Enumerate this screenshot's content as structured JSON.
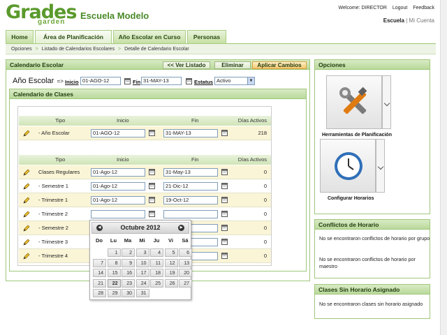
{
  "header": {
    "logo_text": "Grades",
    "logo_sub": "garden",
    "school_name": "Escuela Modelo",
    "welcome": "Welcome: DIRECTOR",
    "logout": "Logout",
    "feedback": "Feedback",
    "school_link": "Escuela",
    "account_link": "Mi Cuenta"
  },
  "nav": {
    "tabs": [
      "Home",
      "Área de Planificación",
      "Año Escolar en Curso",
      "Personas"
    ]
  },
  "breadcrumb": [
    "Opciones",
    "Listado de Calendarios Escolares",
    "Detalle de Calendario Escolar"
  ],
  "calendar_panel": {
    "title": "Calendario Escolar",
    "btn_back": "<< Ver Listado",
    "btn_delete": "Eliminar",
    "btn_apply": "Aplicar Cambios",
    "year_label": "Año Escolar",
    "arrow": "=>",
    "start_label": "Inicio",
    "start_value": "01-AGO-12",
    "end_label": "Fin",
    "end_value": "31-MAY-13",
    "status_label": "Estatus",
    "status_value": "Activo"
  },
  "classes_panel": {
    "title": "Calendario de Clases",
    "columns": [
      "Tipo",
      "Inicio",
      "Fin",
      "Días Activos"
    ],
    "year_row": {
      "name": "- Año Escolar",
      "start": "01-AGO-12",
      "end": "31-MAY-13",
      "days": "218"
    },
    "rows": [
      {
        "name": "Clases Regulares",
        "start": "01-Ago-12",
        "end": "31-May-13",
        "days": "0"
      },
      {
        "name": "- Semestre 1",
        "start": "01-Ago-12",
        "end": "21-Dic-12",
        "days": "0"
      },
      {
        "name": "- Trimestre 1",
        "start": "01-Ago-12",
        "end": "19-Oct-12",
        "days": "0"
      },
      {
        "name": "- Trimestre 2",
        "start": "",
        "end": "",
        "days": "0"
      },
      {
        "name": "- Semestre 2",
        "start": "",
        "end": "",
        "days": "0"
      },
      {
        "name": "- Trimestre 3",
        "start": "",
        "end": "",
        "days": "0"
      },
      {
        "name": "- Trimestre 4",
        "start": "",
        "end": "",
        "days": "0"
      }
    ]
  },
  "datepicker": {
    "month": "Octubre 2012",
    "prev": "◀",
    "next": "▶",
    "weekdays": [
      "Do",
      "Lu",
      "Ma",
      "Mi",
      "Ju",
      "Vi",
      "Sá"
    ],
    "days": [
      "1",
      "2",
      "3",
      "4",
      "5",
      "6",
      "7",
      "8",
      "9",
      "10",
      "11",
      "12",
      "13",
      "14",
      "15",
      "16",
      "17",
      "18",
      "19",
      "20",
      "21",
      "22",
      "23",
      "24",
      "25",
      "26",
      "27",
      "28",
      "29",
      "30",
      "31"
    ],
    "today": "22"
  },
  "options_panel": {
    "title": "Opciones",
    "tools_label": "Herramientas de Planificación",
    "schedule_label": "Configurar Horarios"
  },
  "conflicts_panel": {
    "title": "Conflictos de Horario",
    "msg_group": "No se encontraron conflictos de horario por grupo",
    "msg_teacher": "No se encontraron conflictos de horario por maestro"
  },
  "unassigned_panel": {
    "title": "Clases Sin Horario Asignado",
    "msg": "No se encontraron clases sin horario asignado"
  }
}
